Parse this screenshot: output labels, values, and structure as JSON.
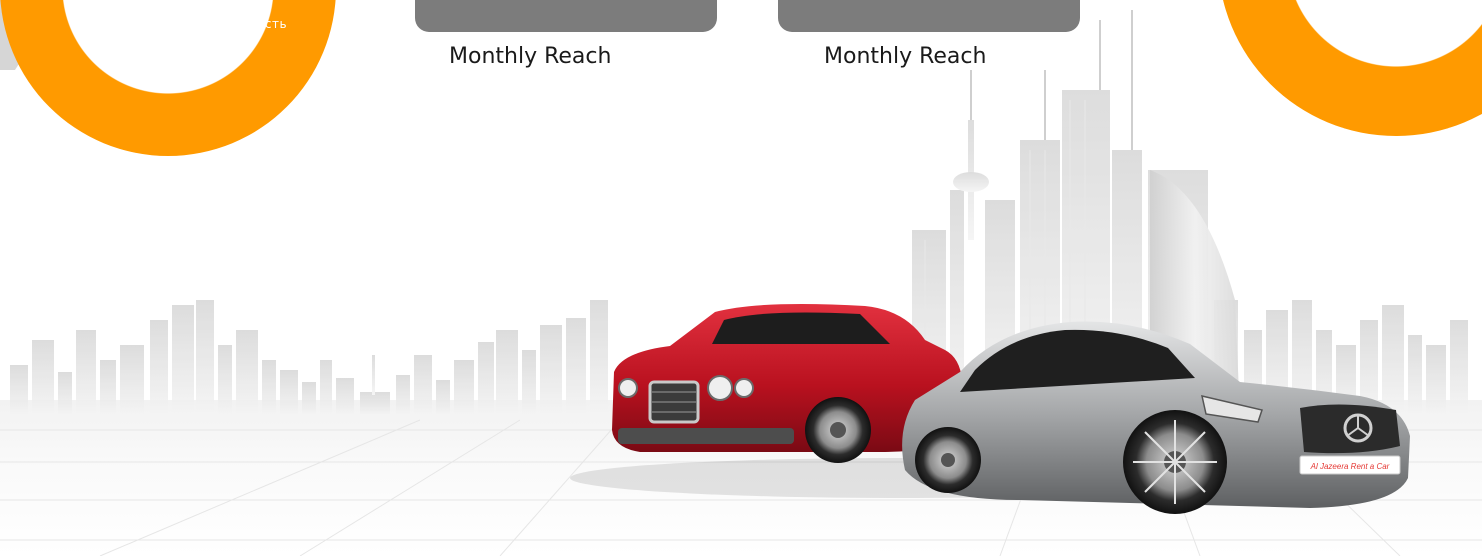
{
  "decor": {
    "ring_text": "есть",
    "accent_color": "#ff9a00",
    "card_color": "#7c7c7c"
  },
  "stats": [
    {
      "label": "Monthly Reach"
    },
    {
      "label": "Monthly Reach"
    }
  ],
  "hero": {
    "image": "city-skyline-with-luxury-cars",
    "plate_text": "Al Jazeera Rent a Car",
    "car_left_color": "#c01e2c",
    "car_right_color": "#a9abad"
  }
}
